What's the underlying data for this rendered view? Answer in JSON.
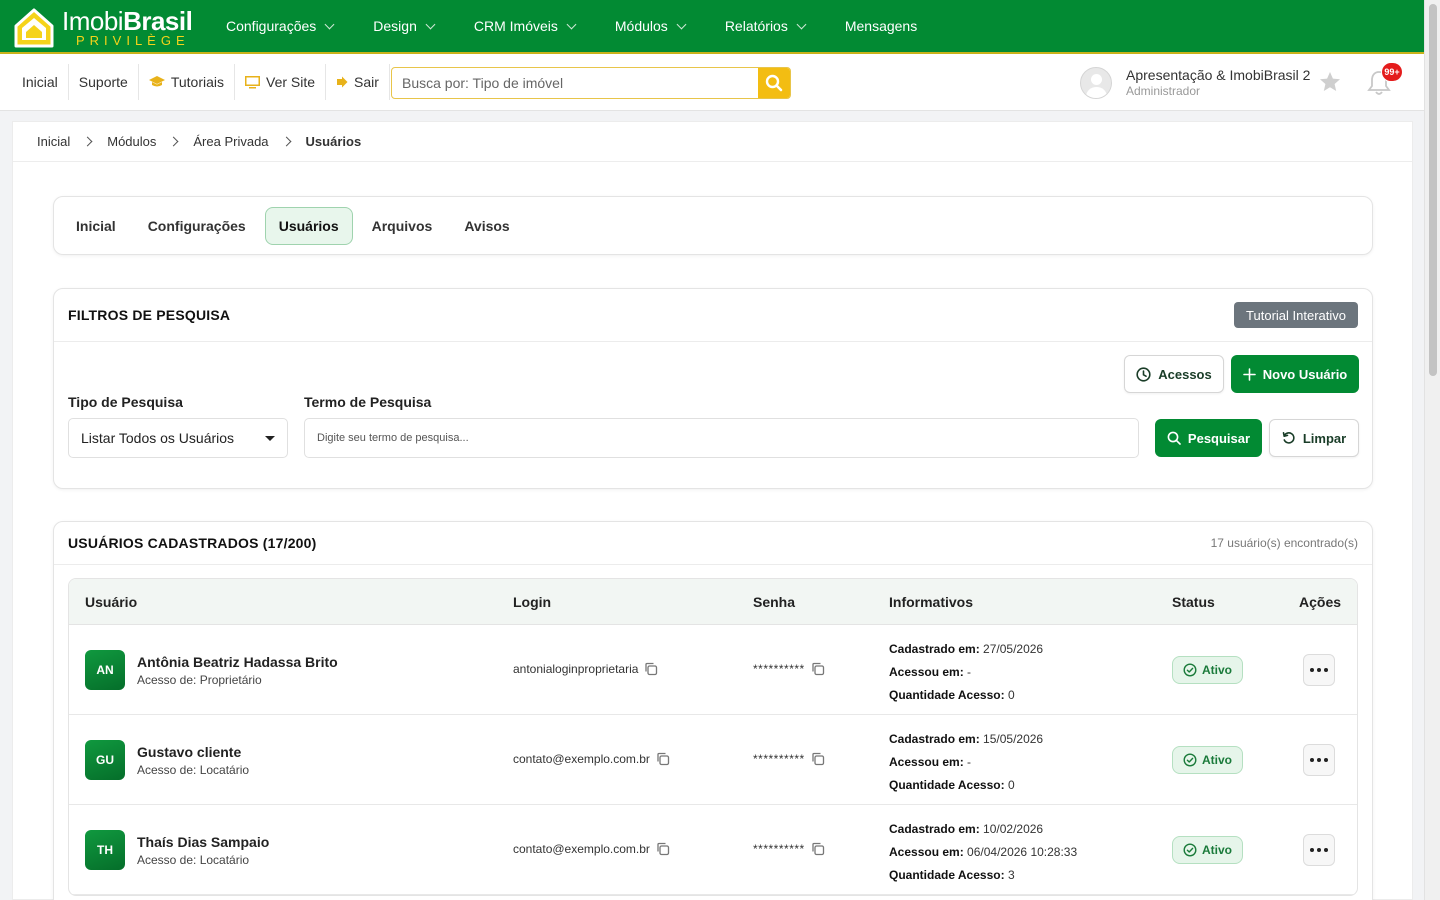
{
  "brand": {
    "name_light": "Imobi",
    "name_bold": "Brasil",
    "tagline": "PRIVILÈGE"
  },
  "topnav": [
    {
      "label": "Configurações",
      "dropdown": true
    },
    {
      "label": "Design",
      "dropdown": true
    },
    {
      "label": "CRM Imóveis",
      "dropdown": true
    },
    {
      "label": "Módulos",
      "dropdown": true
    },
    {
      "label": "Relatórios",
      "dropdown": true
    },
    {
      "label": "Mensagens",
      "dropdown": false
    }
  ],
  "sublinks": {
    "inicial": "Inicial",
    "suporte": "Suporte",
    "tutoriais": "Tutoriais",
    "ver_site": "Ver Site",
    "sair": "Sair"
  },
  "search": {
    "placeholder": "Busca por: Tipo de imóvel"
  },
  "user": {
    "name": "Apresentação & ImobiBrasil 2",
    "role": "Administrador",
    "notifications": "99+"
  },
  "breadcrumb": {
    "b1": "Inicial",
    "b2": "Módulos",
    "b3": "Área Privada",
    "b4": "Usuários"
  },
  "tabs": {
    "t1": "Inicial",
    "t2": "Configurações",
    "t3": "Usuários",
    "t4": "Arquivos",
    "t5": "Avisos"
  },
  "filters": {
    "title": "FILTROS DE PESQUISA",
    "tutorial": "Tutorial Interativo",
    "acessos": "Acessos",
    "novo_usuario": "Novo Usuário",
    "tipo_label": "Tipo de Pesquisa",
    "tipo_value": "Listar Todos os Usuários",
    "termo_label": "Termo de Pesquisa",
    "termo_placeholder": "Digite seu termo de pesquisa...",
    "pesquisar": "Pesquisar",
    "limpar": "Limpar"
  },
  "users": {
    "title": "USUÁRIOS CADASTRADOS (17/200)",
    "count": "17 usuário(s) encontrado(s)",
    "columns": {
      "c1": "Usuário",
      "c2": "Login",
      "c3": "Senha",
      "c4": "Informativos",
      "c5": "Status",
      "c6": "Ações"
    },
    "info_labels": {
      "cadastrado": "Cadastrado em:",
      "acessou": "Acessou em:",
      "quantidade": "Quantidade Acesso:"
    },
    "rows": [
      {
        "initials": "AN",
        "name": "Antônia Beatriz Hadassa Brito",
        "access": "Acesso de: Proprietário",
        "login": "antonialoginproprietaria",
        "password": "**********",
        "cadastrado": "27/05/2026",
        "acessou": "-",
        "quantidade": "0",
        "status": "Ativo"
      },
      {
        "initials": "GU",
        "name": "Gustavo cliente",
        "access": "Acesso de: Locatário",
        "login": "contato@exemplo.com.br",
        "password": "**********",
        "cadastrado": "15/05/2026",
        "acessou": "-",
        "quantidade": "0",
        "status": "Ativo"
      },
      {
        "initials": "TH",
        "name": "Thaís Dias Sampaio",
        "access": "Acesso de: Locatário",
        "login": "contato@exemplo.com.br",
        "password": "**********",
        "cadastrado": "10/02/2026",
        "acessou": "06/04/2026 10:28:33",
        "quantidade": "3",
        "status": "Ativo"
      }
    ]
  },
  "colors": {
    "primary_green": "#028a33",
    "accent_yellow": "#f3bd12",
    "status_green": "#1a7a3a",
    "badge_red": "#e41c1c"
  }
}
